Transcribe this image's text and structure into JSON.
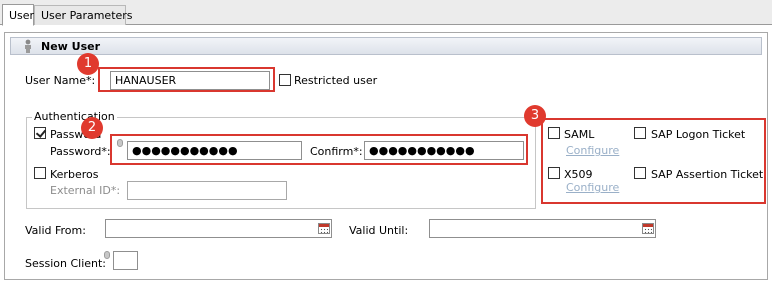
{
  "tabs": [
    {
      "label": "User"
    },
    {
      "label": "User Parameters"
    }
  ],
  "header": {
    "title": "New User"
  },
  "form": {
    "user_name_label": "User Name*:",
    "user_name_value": "HANAUSER",
    "restricted_user_label": "Restricted user",
    "authentication_label": "Authentication",
    "password_checkbox_label": "Password",
    "password_label": "Password*:",
    "password_value": "●●●●●●●●●●●",
    "confirm_label": "Confirm*:",
    "confirm_value": "●●●●●●●●●●●",
    "kerberos_label": "Kerberos",
    "external_id_label": "External ID*:",
    "saml_label": "SAML",
    "saml_configure": "Configure",
    "x509_label": "X509",
    "x509_configure": "Configure",
    "sap_logon_ticket_label": "SAP Logon Ticket",
    "sap_assertion_ticket_label": "SAP Assertion Ticket",
    "valid_from_label": "Valid From:",
    "valid_until_label": "Valid Until:",
    "session_client_label": "Session Client:"
  },
  "callouts": [
    "1",
    "2",
    "3"
  ],
  "colors": {
    "callout_red": "#d9372f",
    "link": "#9ab0c8"
  }
}
